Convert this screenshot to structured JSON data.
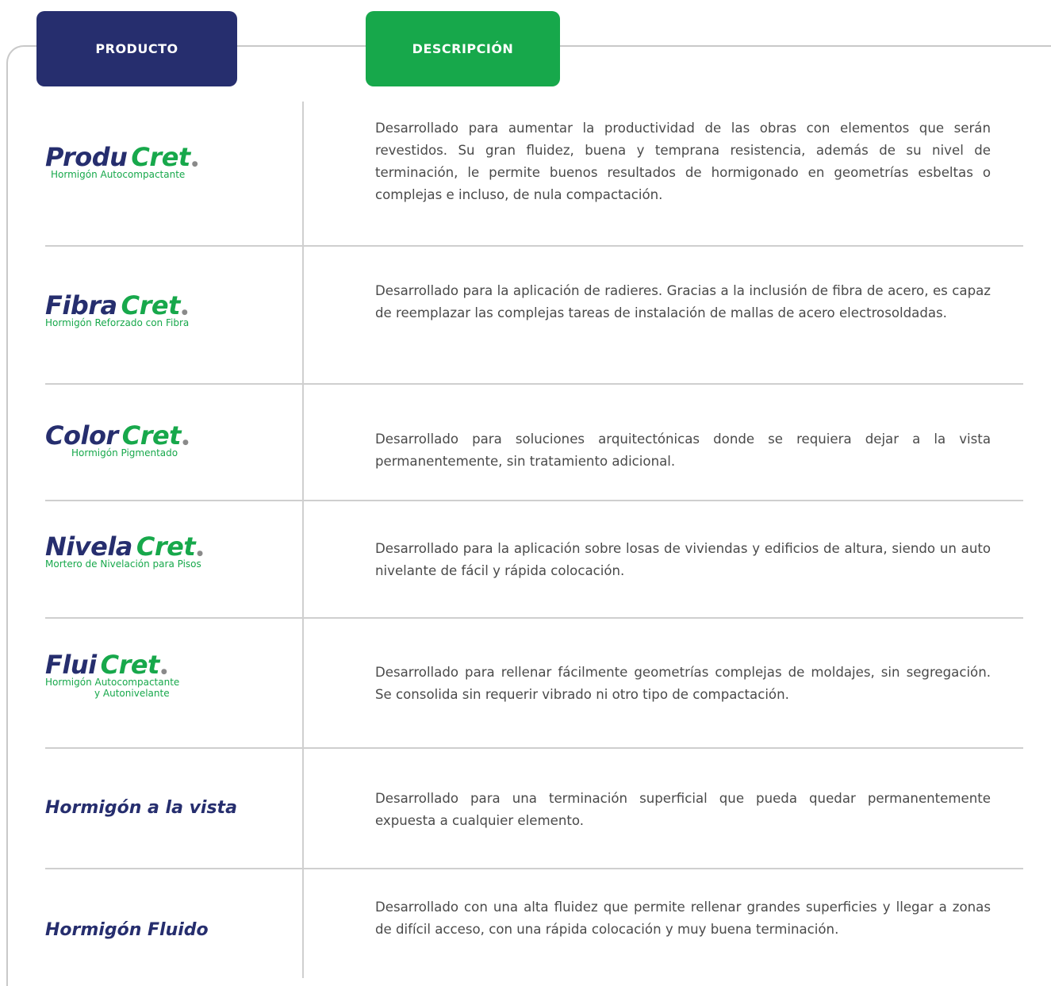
{
  "headers": {
    "product": "PRODUCTO",
    "description": "DESCRIPCIÓN"
  },
  "colors": {
    "navy": "#262e6e",
    "green": "#17a84b",
    "line": "#c9c9c9",
    "text": "#4a4a4a"
  },
  "rows": [
    {
      "brand": "Produ",
      "mark": "Cret",
      "subtitle": "Hormigón Autocompactante",
      "description": "Desarrollado para aumentar la productividad de las obras con elementos que serán revestidos. Su gran fluidez, buena y temprana resistencia, además de su nivel de terminación, le permite buenos resultados de hormigonado en geometrías esbeltas o complejas e incluso, de nula compactación."
    },
    {
      "brand": "Fibra",
      "mark": "Cret",
      "subtitle": "Hormigón Reforzado con Fibra",
      "description": "Desarrollado para la aplicación de radieres. Gracias a la inclusión de fibra de acero, es capaz de reemplazar las complejas tareas de instalación de mallas de acero electrosoldadas."
    },
    {
      "brand": "Color",
      "mark": "Cret",
      "subtitle": "Hormigón Pigmentado",
      "description": "Desarrollado para soluciones arquitectónicas donde se requiera dejar a la vista permanentemente, sin tratamiento adicional."
    },
    {
      "brand": "Nivela",
      "mark": "Cret",
      "subtitle": "Mortero de Nivelación para Pisos",
      "description": "Desarrollado para la aplicación sobre losas de viviendas y edificios de altura, siendo un auto nivelante de fácil y rápida colocación."
    },
    {
      "brand": "Flui",
      "mark": "Cret",
      "subtitle": "Hormigón Autocompactante",
      "subtitle2": "y Autonivelante",
      "description": "Desarrollado para rellenar fácilmente geometrías complejas de moldajes, sin segregación. Se consolida sin requerir vibrado ni otro tipo de compactación."
    },
    {
      "name": "Hormigón a la vista",
      "description": "Desarrollado para una terminación superficial que pueda quedar permanentemente expuesta a cualquier elemento."
    },
    {
      "name": "Hormigón Fluido",
      "description": "Desarrollado con una alta fluidez que permite rellenar grandes superficies y llegar a zonas de difícil acceso, con una rápida colocación y muy buena terminación."
    }
  ]
}
